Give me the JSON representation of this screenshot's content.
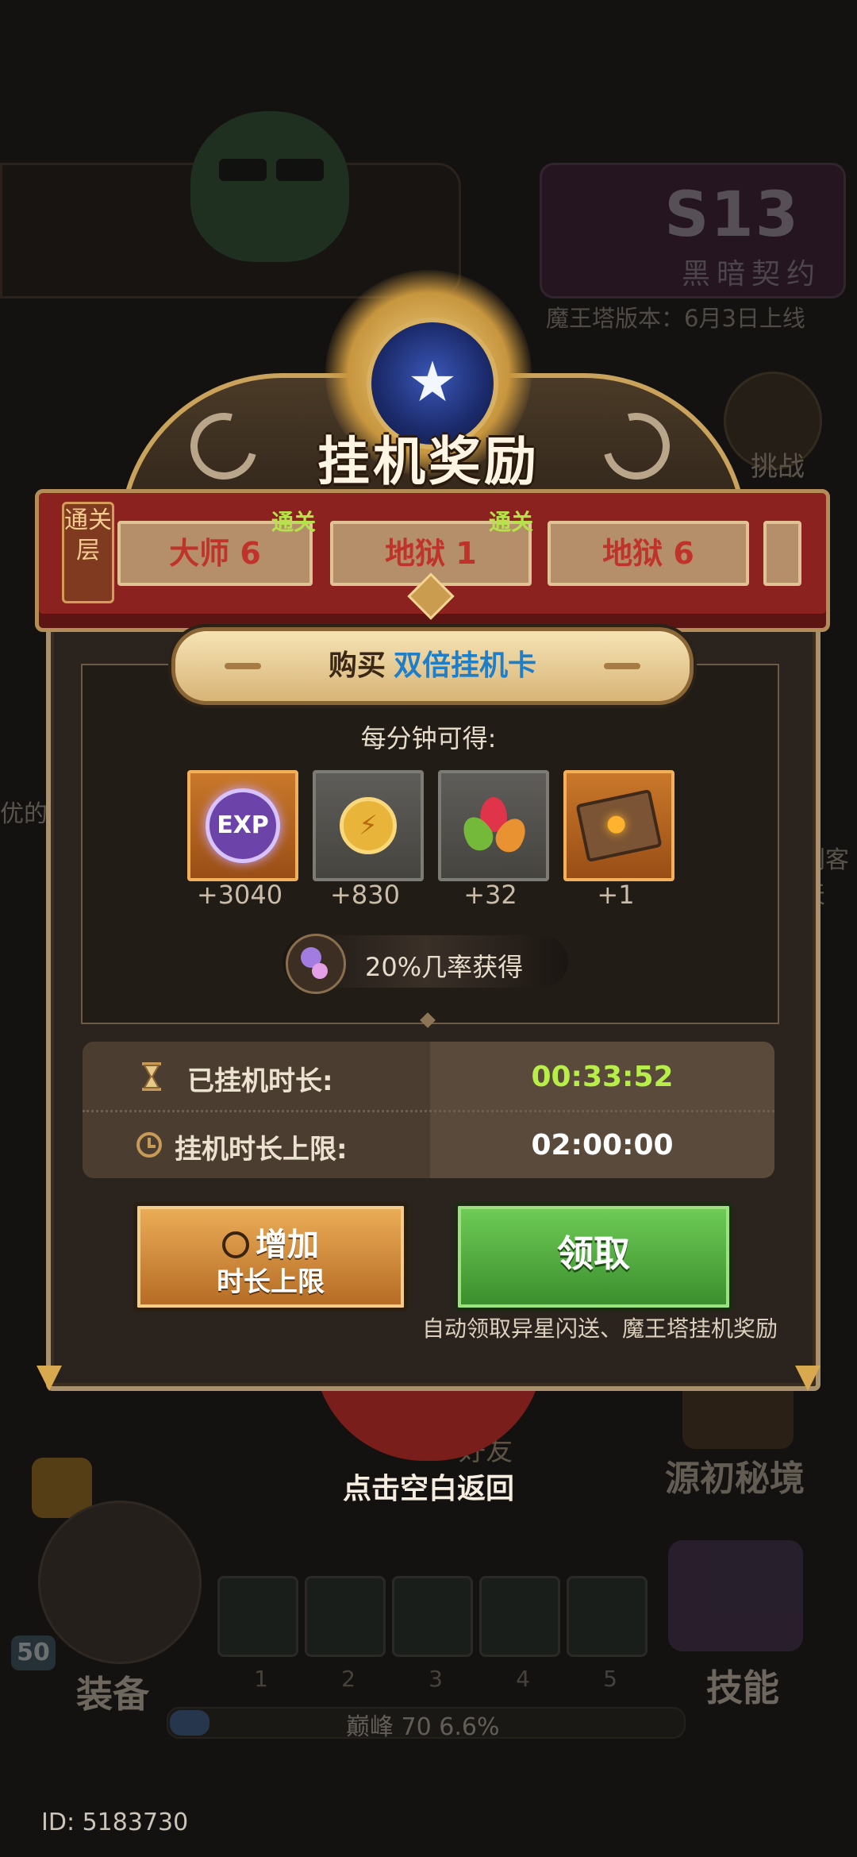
{
  "background": {
    "s13_label": "S13",
    "s13_subtitle": "黑暗契约",
    "version_text": "魔王塔版本：6月3日上线",
    "challenge_label": "挑战",
    "friend_label": "好友",
    "secret_realm_label": "源初秘境",
    "equip_label": "装备",
    "skill_label": "技能",
    "level": "50",
    "skill_slots": [
      "1",
      "2",
      "3",
      "4",
      "5"
    ],
    "peak_text": "巅峰 70    6.6%",
    "player_id": "ID: 5183730",
    "left_snippet": "优的/",
    "right_snippet": "刺客天"
  },
  "popup": {
    "title": "挂机奖励",
    "floor_tag": "通关层",
    "stages": [
      {
        "name": "大师 6",
        "cleared": "通关"
      },
      {
        "name": "地狱 1",
        "cleared": "通关"
      },
      {
        "name": "地狱 6",
        "cleared": ""
      }
    ],
    "buy_prefix": "购买",
    "buy_item": "双倍挂机卡",
    "per_minute_label": "每分钟可得:",
    "rewards": [
      {
        "icon": "exp-icon",
        "icon_text": "EXP",
        "amount": "+3040"
      },
      {
        "icon": "gold-coin-icon",
        "icon_text": "⚡",
        "amount": "+830"
      },
      {
        "icon": "gems-icon",
        "icon_text": "",
        "amount": "+32"
      },
      {
        "icon": "treasure-chest-icon",
        "icon_text": "",
        "amount": "+1"
      }
    ],
    "chance_text": "20%几率获得",
    "idle_time_label": "已挂机时长:",
    "idle_time_value": "00:33:52",
    "idle_limit_label": "挂机时长上限:",
    "idle_limit_value": "02:00:00",
    "increase_line1": "增加",
    "increase_line2": "时长上限",
    "claim_label": "领取",
    "auto_note": "自动领取异星闪送、魔王塔挂机奖励",
    "tap_return": "点击空白返回"
  },
  "colors": {
    "idle_time_value": "#b7ee4a",
    "idle_limit_value": "#ffffff",
    "stage_text": "#c0332b",
    "cleared_text": "#b6e24a",
    "buy_item": "#1e7ec8"
  }
}
